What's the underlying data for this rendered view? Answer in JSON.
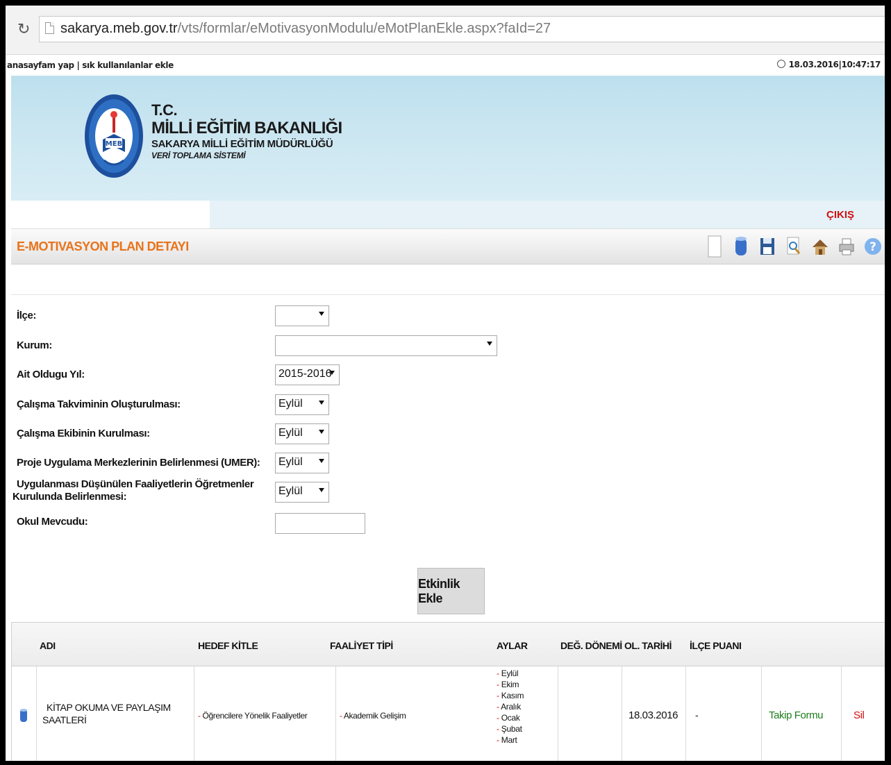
{
  "browser": {
    "url_host": "sakarya.meb.gov.tr",
    "url_path": "/vts/formlar/eMotivasyonModulu/eMotPlanEkle.aspx?faId=27"
  },
  "toplinks": {
    "left": "anasayfam yap | sık kullanılanlar ekle",
    "datetime": "18.03.2016|10:47:17"
  },
  "header": {
    "logo_text": "MEB",
    "tc": "T.C.",
    "ministry": "MİLLİ EĞİTİM BAKANLIĞI",
    "directorate": "SAKARYA MİLLİ EĞİTİM MÜDÜRLÜĞÜ",
    "system": "VERİ TOPLAMA SİSTEMİ",
    "logout": "ÇIKIŞ"
  },
  "page": {
    "title": "E-MOTIVASYON PLAN DETAYI"
  },
  "toolbar": {
    "icons": [
      "new-document-icon",
      "database-icon",
      "save-icon",
      "search-document-icon",
      "home-icon",
      "print-icon",
      "help-icon"
    ],
    "help_glyph": "?"
  },
  "form": {
    "ilce_label": "İlçe:",
    "ilce_value": "",
    "kurum_label": "Kurum:",
    "kurum_value": "",
    "yil_label": "Ait Oldugu Yıl:",
    "yil_value": "2015-2016",
    "takvim_label": "Çalışma Takviminin Oluşturulması:",
    "takvim_value": "Eylül",
    "ekip_label": "Çalışma Ekibinin Kurulması:",
    "ekip_value": "Eylül",
    "umer_label": "Proje Uygulama Merkezlerinin Belirlenmesi (UMER):",
    "umer_value": "Eylül",
    "faaliyet_label_line1": "Uygulanması Düşünülen Faaliyetlerin Öğretmenler",
    "faaliyet_label_line2": "Kurulunda Belirlenmesi:",
    "faaliyet_value": "Eylül",
    "mevcut_label": "Okul Mevcudu:",
    "mevcut_value": "",
    "add_button": "Etkinlik Ekle"
  },
  "table": {
    "headers": {
      "adi": "ADI",
      "hedef": "HEDEF KİTLE",
      "tip": "FAALİYET TİPİ",
      "aylar": "AYLAR",
      "donem": "DEĞ. DÖNEMİ",
      "tarih": "OL. TARİHİ",
      "puan": "İLÇE PUANI"
    },
    "row": {
      "adi_line1": "KİTAP OKUMA VE PAYLAŞIM",
      "adi_line2": "SAATLERİ",
      "hedef": "Öğrencilere Yönelik Faaliyetler",
      "tip": "Akademik Gelişim",
      "aylar": [
        "Eylül",
        "Ekim",
        "Kasım",
        "Aralık",
        "Ocak",
        "Şubat",
        "Mart"
      ],
      "donem": "",
      "tarih": "18.03.2016",
      "puan": "-",
      "takip": "Takip Formu",
      "sil": "Sil",
      "dash": "-"
    }
  },
  "colors": {
    "accent_orange": "#e8731a",
    "logout_red": "#d01010",
    "link_green": "#1d7d1d",
    "banner_blue": "#c6e4f0"
  }
}
